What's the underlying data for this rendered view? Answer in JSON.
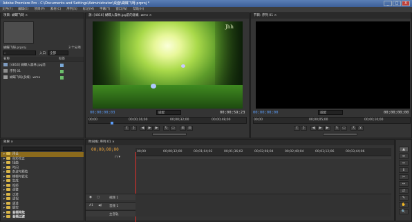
{
  "window": {
    "title": "Adobe Premiere Pro - C:\\Documents and Settings\\Administrator\\桌面\\蝴蝶飞呀.prproj *",
    "minimize": "_",
    "maximize": "□",
    "close": "X"
  },
  "menu": [
    "文件(F)",
    "编辑(E)",
    "项目(P)",
    "素材(C)",
    "序列(S)",
    "标记(M)",
    "字幕(T)",
    "窗口(W)",
    "帮助(H)"
  ],
  "project": {
    "tab": "项目: 蝴蝶飞呀 ×",
    "filename": "蝴蝶飞呀.prproj",
    "count": "3 个分项",
    "search_placeholder": "",
    "in_label": "入口:",
    "in_value": "全部",
    "col_name": "名称",
    "col_label": "标签",
    "items": [
      {
        "name": "[4816] 蝴蝶入森林.jpg前",
        "color": "#7aa9d8"
      },
      {
        "name": "序列 01",
        "color": "#6cbf6c"
      },
      {
        "name": "蝴蝶飞呀(多媒) .wma",
        "color": "#6cbf6c"
      }
    ]
  },
  "source": {
    "tab": "源: [4816] 蝴蝶入森林.jpg前的源素 .wmv ×",
    "watermark": "Jhh",
    "timecode_in": "00;00;00;03",
    "fit": "适配",
    "duration": "00;00;59;23",
    "ruler": [
      "00;00",
      "00;00;16;00",
      "00;00;32;00",
      "00;00;48;00"
    ]
  },
  "program": {
    "tab": "节目: 序列 01 ×",
    "timecode_in": "00;00;00;00",
    "fit": "适配",
    "duration": "00;00;00;00",
    "ruler": [
      "00;00",
      "00;00;05;00",
      "00;00;10;00"
    ]
  },
  "effects": {
    "tab": "效果 ×",
    "tree": [
      {
        "label": "预设",
        "folder": true,
        "highlight": true
      },
      {
        "label": "色彩校正",
        "folder": true
      },
      {
        "label": "扭曲",
        "folder": true
      },
      {
        "label": "时间",
        "folder": true
      },
      {
        "label": "杂波与颗粒",
        "folder": true
      },
      {
        "label": "模糊与锐化",
        "folder": true
      },
      {
        "label": "生成",
        "folder": true
      },
      {
        "label": "视频",
        "folder": true
      },
      {
        "label": "调整",
        "folder": true
      },
      {
        "label": "过渡",
        "folder": true
      },
      {
        "label": "透视",
        "folder": true
      },
      {
        "label": "通道",
        "folder": true
      },
      {
        "label": "键控",
        "folder": true
      },
      {
        "label": "音频特效",
        "folder": true,
        "bold": true
      },
      {
        "label": "音频过渡",
        "folder": true,
        "bold": true
      }
    ]
  },
  "timeline": {
    "tab": "时间线: 序列 01 ×",
    "timecode": "00;00;00;00",
    "ruler": [
      "00;00",
      "00;00;32;00",
      "00;01;04;02",
      "00;01;36;02",
      "00;02;08;04",
      "00;02;40;04",
      "00;03;12;06",
      "00;03;44;06"
    ],
    "video_track": "视频 1",
    "audio_track": "音频 1",
    "audio_label": "A1",
    "master": "主音轨"
  },
  "tools": [
    "▲",
    "⇹",
    "⇔",
    "⇕",
    "✂",
    "↔",
    "⇄",
    "✎",
    "✋",
    "🔍"
  ],
  "colors": {
    "playhead": "#e8302a",
    "timecode": "#5b9bf5"
  }
}
